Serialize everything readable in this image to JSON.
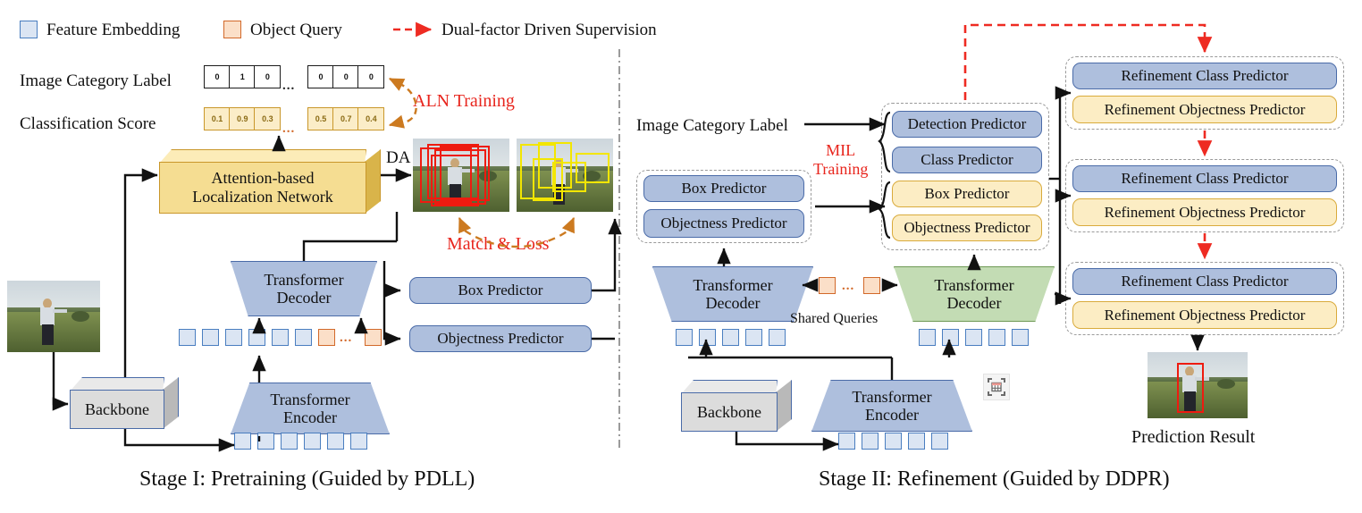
{
  "legend": {
    "items": [
      {
        "name": "feature-embedding",
        "label": "Feature Embedding",
        "swatch": "#dbe5f3",
        "border": "#4a7ec0"
      },
      {
        "name": "object-query",
        "label": "Object Query",
        "swatch": "#fbdfc8",
        "border": "#d2692a"
      },
      {
        "name": "dual-factor",
        "label": "Dual-factor Driven Supervision",
        "color": "#ee2b22"
      }
    ]
  },
  "stage1": {
    "caption": "Stage I: Pretraining (Guided by PDLL)",
    "image_category_label": "Image Category Label",
    "classification_score": "Classification Score",
    "label_cells_left": [
      "0",
      "1",
      "0"
    ],
    "label_cells_right": [
      "0",
      "0",
      "0"
    ],
    "score_cells_left": [
      "0.1",
      "0.9",
      "0.3"
    ],
    "score_cells_right": [
      "0.5",
      "0.7",
      "0.4"
    ],
    "ellipsis": "...",
    "aln_training": "ALN Training",
    "match_loss": "Match & Loss",
    "da_label": "DA",
    "aln_network_l1": "Attention-based",
    "aln_network_l2": "Localization Network",
    "transformer_decoder_l1": "Transformer",
    "transformer_decoder_l2": "Decoder",
    "transformer_encoder_l1": "Transformer",
    "transformer_encoder_l2": "Encoder",
    "backbone": "Backbone",
    "box_predictor": "Box Predictor",
    "objectness_predictor": "Objectness Predictor"
  },
  "stage2": {
    "caption": "Stage II: Refinement (Guided by DDPR)",
    "image_category_label": "Image Category Label",
    "mil_training_l1": "MIL",
    "mil_training_l2": "Training",
    "shared_queries": "Shared Queries",
    "prediction_result": "Prediction Result",
    "transformer_decoder_l1": "Transformer",
    "transformer_decoder_l2": "Decoder",
    "transformer_encoder_l1": "Transformer",
    "transformer_encoder_l2": "Encoder",
    "backbone": "Backbone",
    "left_group": {
      "box_predictor": "Box Predictor",
      "objectness_predictor": "Objectness Predictor"
    },
    "mil_group": {
      "detection_predictor": "Detection Predictor",
      "class_predictor": "Class Predictor",
      "box_predictor": "Box Predictor",
      "objectness_predictor": "Objectness Predictor"
    },
    "refinement_groups": [
      {
        "class_predictor": "Refinement Class Predictor",
        "objectness_predictor": "Refinement Objectness Predictor"
      },
      {
        "class_predictor": "Refinement Class Predictor",
        "objectness_predictor": "Refinement Objectness Predictor"
      },
      {
        "class_predictor": "Refinement Class Predictor",
        "objectness_predictor": "Refinement Objectness Predictor"
      }
    ]
  },
  "colors": {
    "blue_fill": "#aebfdd",
    "blue_border": "#4a6ba8",
    "yellow_fill": "#fcedc4",
    "yellow_border": "#d9ab3c",
    "green_fill": "#c3dcb4",
    "green_border": "#6f9a56",
    "gray_fill": "#dcdcdc",
    "red": "#ee2b22",
    "orange_dashed": "#cc7a20",
    "token_fill": "#dbe5f3",
    "query_fill": "#fbdfc8"
  }
}
